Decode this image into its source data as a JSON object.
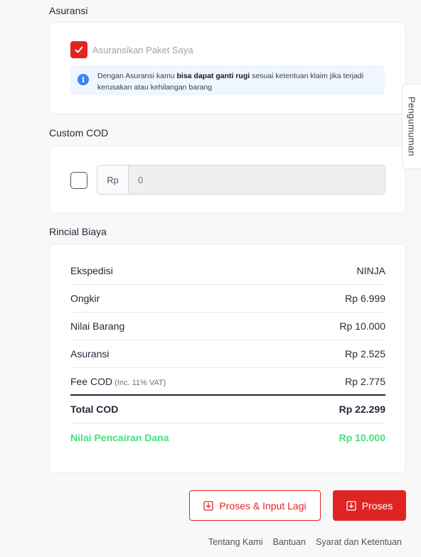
{
  "asuransi": {
    "title": "Asuransi",
    "checkbox_label": "Asuransikan Paket Saya",
    "checked": true,
    "info_pre": "Dengan Asuransi kamu ",
    "info_bold": "bisa dapat ganti rugi",
    "info_post": " sesuai ketentuan klaim jika terjadi kerusakan atau kehilangan barang"
  },
  "custom_cod": {
    "title": "Custom COD",
    "checked": false,
    "prefix": "Rp",
    "placeholder": "0"
  },
  "rincian": {
    "title": "Rincial Biaya",
    "rows": [
      {
        "label": "Ekspedisi",
        "value": "NINJA"
      },
      {
        "label": "Ongkir",
        "value": "Rp 6.999"
      },
      {
        "label": "Nilai Barang",
        "value": "Rp 10.000"
      },
      {
        "label": "Asuransi",
        "value": "Rp 2.525"
      },
      {
        "label": "Fee COD",
        "note": "(Inc. 11% VAT)",
        "value": "Rp 2.775"
      }
    ],
    "total": {
      "label": "Total COD",
      "value": "Rp 22.299"
    },
    "pencairan": {
      "label": "Nilai Pencairan Dana",
      "value": "Rp 10.000"
    }
  },
  "actions": {
    "proses_input_lagi": "Proses & Input Lagi",
    "proses": "Proses"
  },
  "footer": {
    "links": [
      "Tentang Kami",
      "Bantuan",
      "Syarat dan Ketentuan"
    ]
  },
  "side_tab": {
    "label": "Pengumuman"
  },
  "colors": {
    "accent_red": "#e02424",
    "success_green": "#4ade80",
    "info_blue": "#3b82f6"
  },
  "icons": {
    "checkbox": "check-icon",
    "info": "info-icon",
    "download": "download-box-icon"
  }
}
